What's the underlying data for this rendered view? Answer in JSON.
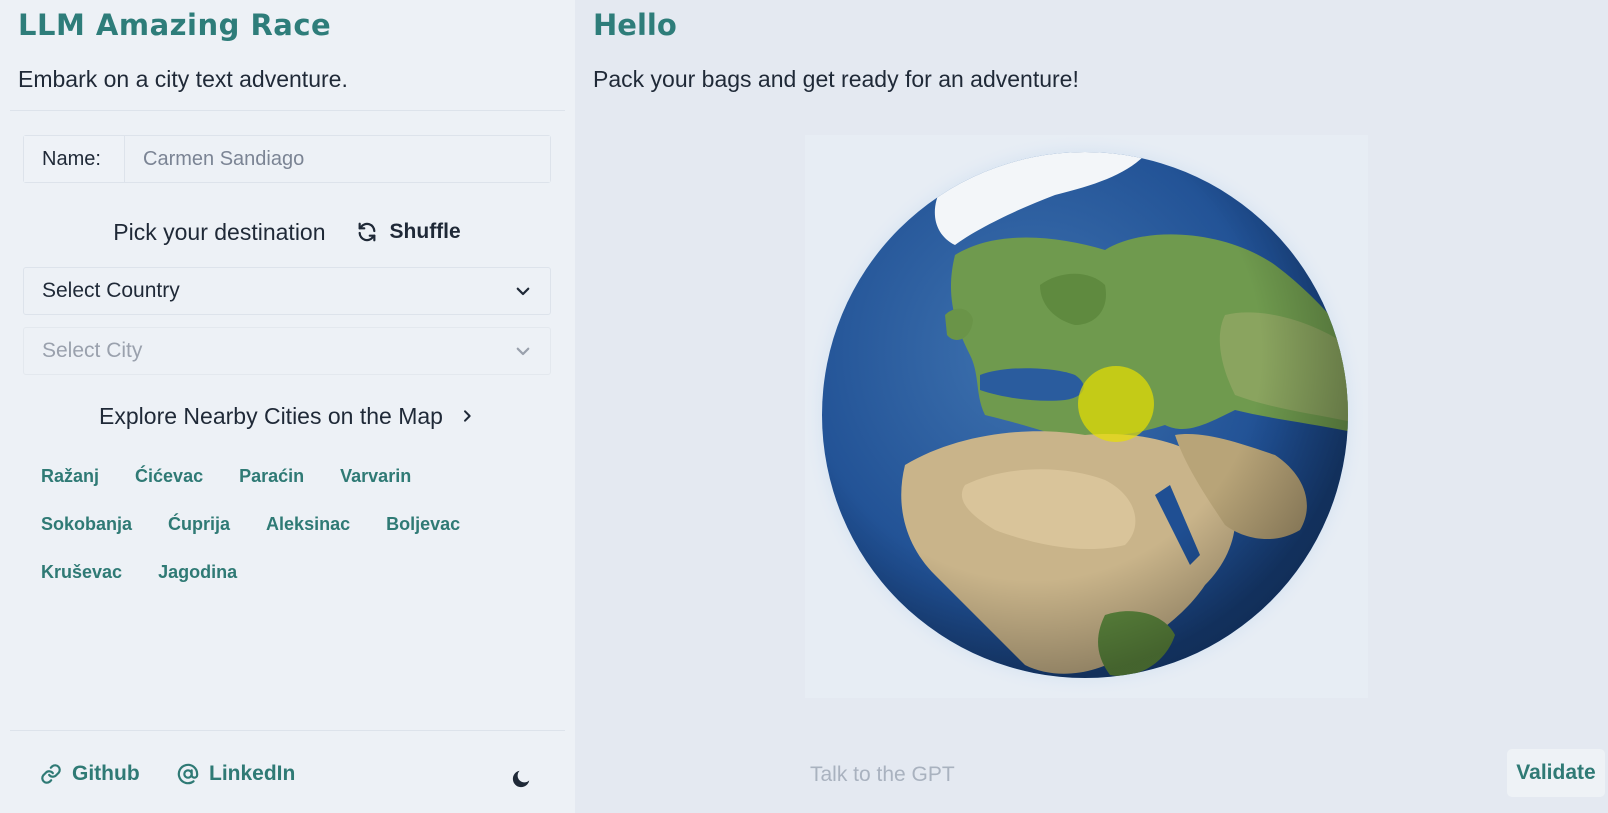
{
  "sidebar": {
    "app_title": "LLM Amazing Race",
    "subtitle": "Embark on a city text adventure.",
    "name_label": "Name:",
    "name_placeholder": "Carmen Sandiago",
    "name_value": "",
    "pick_label": "Pick your destination",
    "shuffle_label": "Shuffle",
    "country_select": "Select Country",
    "city_select": "Select City",
    "explore_label": "Explore Nearby Cities on the Map",
    "nearby_cities": [
      "Ražanj",
      "Ćićevac",
      "Paraćin",
      "Varvarin",
      "Sokobanja",
      "Ćuprija",
      "Aleksinac",
      "Boljevac",
      "Kruševac",
      "Jagodina"
    ],
    "footer": {
      "github_label": "Github",
      "linkedin_label": "LinkedIn"
    }
  },
  "main": {
    "greeting": "Hello",
    "tagline": "Pack your bags and get ready for an adventure!",
    "chat_placeholder": "Talk to the GPT",
    "validate_label": "Validate"
  },
  "theme": {
    "accent": "#2e7d7a",
    "sidebar_bg": "#edf1f6",
    "main_bg": "#e4e9f1",
    "marker_color": "#e8e000"
  },
  "icons": {
    "shuffle": "refresh-icon",
    "select": "chevron-down-icon",
    "explore": "chevron-right-icon",
    "github": "link-icon",
    "linkedin": "at-icon",
    "theme_toggle": "moon-icon"
  }
}
